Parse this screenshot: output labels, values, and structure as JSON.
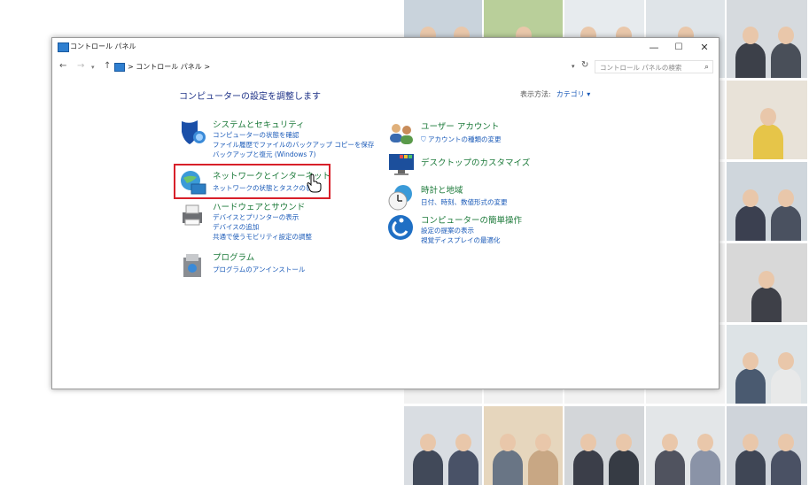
{
  "window": {
    "title": "コントロール パネル",
    "minimize": "—",
    "maximize": "☐",
    "close": "✕"
  },
  "nav": {
    "back": "←",
    "forward": "→",
    "recent": "▾",
    "up": "↑",
    "address": "> コントロール パネル >",
    "address_dropdown": "▾",
    "refresh": "↻",
    "search_placeholder": "コントロール パネルの検索",
    "search_icon": "⌕"
  },
  "main": {
    "heading": "コンピューターの設定を調整します",
    "view_by_label": "表示方法:",
    "view_by_value": "カテゴリ ▾"
  },
  "categories_left": [
    {
      "title": "システムとセキュリティ",
      "links": [
        "コンピューターの状態を確認",
        "ファイル履歴でファイルのバックアップ コピーを保存",
        "バックアップと復元 (Windows 7)"
      ]
    },
    {
      "title": "ネットワークとインターネット",
      "links": [
        "ネットワークの状態とタスクの表示"
      ]
    },
    {
      "title": "ハードウェアとサウンド",
      "links": [
        "デバイスとプリンターの表示",
        "デバイスの追加",
        "共通で使うモビリティ設定の調整"
      ]
    },
    {
      "title": "プログラム",
      "links": [
        "プログラムのアンインストール"
      ]
    }
  ],
  "categories_right": [
    {
      "title": "ユーザー アカウント",
      "links": [
        "アカウントの種類の変更"
      ]
    },
    {
      "title": "デスクトップのカスタマイズ",
      "links": []
    },
    {
      "title": "時計と地域",
      "links": [
        "日付、時刻、数値形式の変更"
      ]
    },
    {
      "title": "コンピューターの簡単操作",
      "links": [
        "設定の提案の表示",
        "視覚ディスプレイの最適化"
      ]
    }
  ],
  "colors": {
    "category_title": "#1c7a3a",
    "link": "#1a5ab8",
    "heading": "#1e3287",
    "highlight": "#d8202a"
  }
}
